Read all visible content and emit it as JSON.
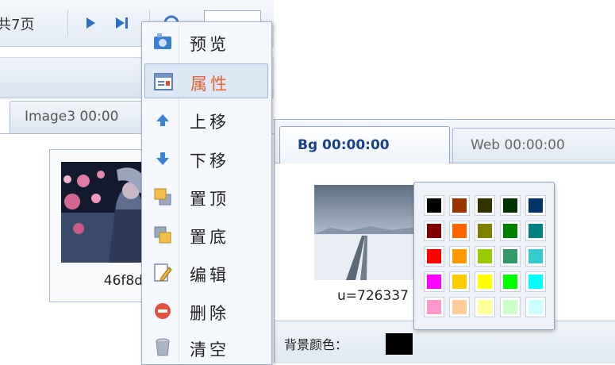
{
  "pager": {
    "page_count_label": "共7页",
    "page_input_value": "",
    "buttons": [
      "play-icon",
      "last-page-icon",
      "refresh-icon"
    ]
  },
  "left_panel": {
    "tab_label": "Image3 00:00",
    "thumb_caption": "46f8d"
  },
  "context_menu": {
    "items": [
      {
        "label": "预览",
        "icon": "preview-icon"
      },
      {
        "label": "属性",
        "icon": "properties-icon",
        "selected": true
      },
      {
        "label": "上移",
        "icon": "move-up-icon"
      },
      {
        "label": "下移",
        "icon": "move-down-icon"
      },
      {
        "label": "置顶",
        "icon": "bring-to-top-icon"
      },
      {
        "label": "置底",
        "icon": "send-to-bottom-icon"
      },
      {
        "label": "编辑",
        "icon": "edit-icon"
      },
      {
        "label": "删除",
        "icon": "delete-icon"
      },
      {
        "label": "清空",
        "icon": "clear-icon"
      }
    ],
    "selected_color": "#e8612c"
  },
  "right_panel": {
    "tabs": [
      {
        "label": "Bg 00:00:00",
        "active": true
      },
      {
        "label": "Web 00:00:00",
        "active": false
      }
    ],
    "thumb_caption": "u=726337",
    "bg_color_label": "背景颜色：",
    "bg_color_value": "#000000"
  },
  "color_palette": {
    "rows": [
      [
        "#000000",
        "#993300",
        "#333300",
        "#003300",
        "#003366"
      ],
      [
        "#800000",
        "#ff6600",
        "#808000",
        "#008000",
        "#008080"
      ],
      [
        "#ff0000",
        "#ff9900",
        "#99cc00",
        "#339966",
        "#33cccc"
      ],
      [
        "#ff00ff",
        "#ffcc00",
        "#ffff00",
        "#00ff00",
        "#00ffff"
      ],
      [
        "#ff99cc",
        "#ffcc99",
        "#ffff99",
        "#ccffcc",
        "#ccffff"
      ]
    ]
  }
}
